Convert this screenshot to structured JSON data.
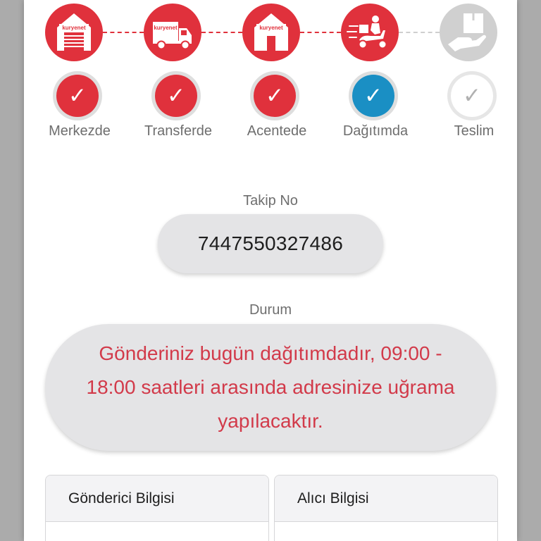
{
  "colors": {
    "accent_red": "#e0313c",
    "completed_blue": "#1a8fc4",
    "pending_gray": "#cfcfcf",
    "status_text": "#d23a4a"
  },
  "stepper": {
    "steps": [
      {
        "label": "Merkezde",
        "icon": "warehouse-icon",
        "logo": "kuryenet",
        "state": "done"
      },
      {
        "label": "Transferde",
        "icon": "truck-icon",
        "logo": "kuryenet",
        "state": "done"
      },
      {
        "label": "Acentede",
        "icon": "agency-house-icon",
        "logo": "kuryenet",
        "state": "done"
      },
      {
        "label": "Dağıtımda",
        "icon": "scooter-courier-icon",
        "state": "current"
      },
      {
        "label": "Teslim",
        "icon": "package-delivered-icon",
        "state": "pending"
      }
    ]
  },
  "tracking": {
    "label": "Takip No",
    "number": "7447550327486"
  },
  "status": {
    "label": "Durum",
    "message": "Gönderiniz bugün dağıtımdadır, 09:00 - 18:00 saatleri arasında adresinize uğrama yapılacaktır."
  },
  "info": {
    "sender_title": "Gönderici Bilgisi",
    "receiver_title": "Alıcı Bilgisi"
  }
}
